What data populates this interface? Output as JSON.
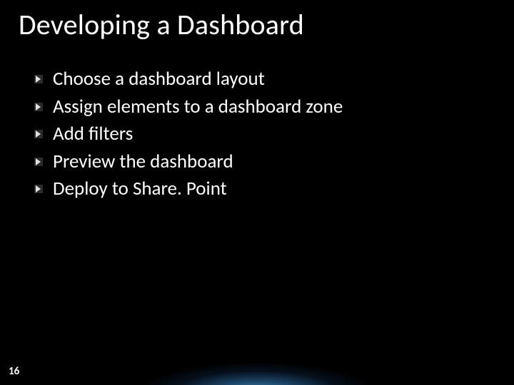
{
  "slide": {
    "title": "Developing a Dashboard",
    "bullets": [
      "Choose a dashboard layout",
      "Assign elements to a dashboard zone",
      "Add filters",
      "Preview the dashboard",
      "Deploy to Share. Point"
    ],
    "page_number": "16"
  }
}
